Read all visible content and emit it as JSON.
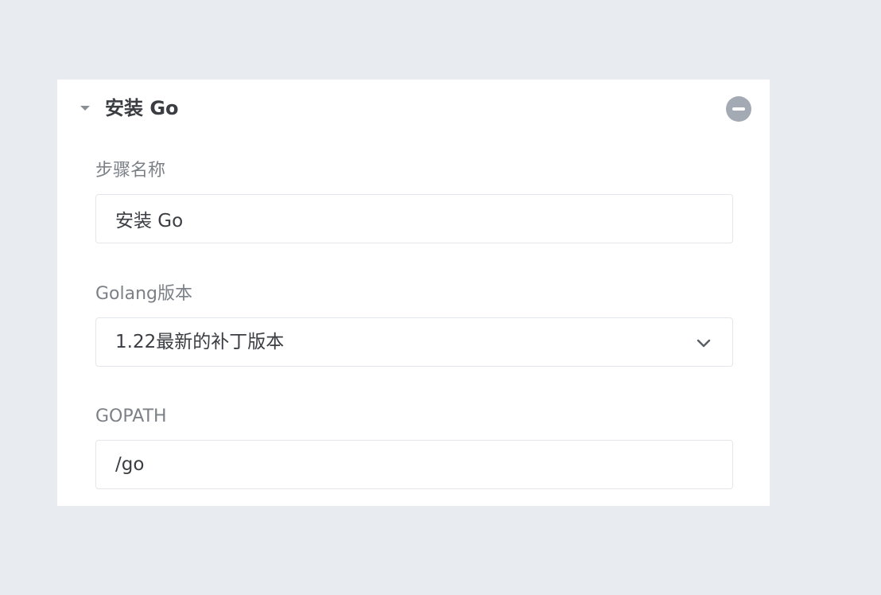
{
  "step": {
    "title": "安装 Go",
    "collapse_icon": "caret-down-icon",
    "remove_icon": "minus-circle-icon"
  },
  "fields": {
    "step_name": {
      "label": "步骤名称",
      "value": "安装 Go"
    },
    "golang_version": {
      "label": "Golang版本",
      "selected": "1.22最新的补丁版本",
      "icon": "chevron-down-icon"
    },
    "gopath": {
      "label": "GOPATH",
      "value": "/go"
    }
  },
  "colors": {
    "page_background": "#e8ebef",
    "panel_background": "#ffffff",
    "remove_button": "#a4aab4",
    "label_text": "#7c8087",
    "value_text": "#3a3d42",
    "field_border": "#e3e6ea"
  }
}
